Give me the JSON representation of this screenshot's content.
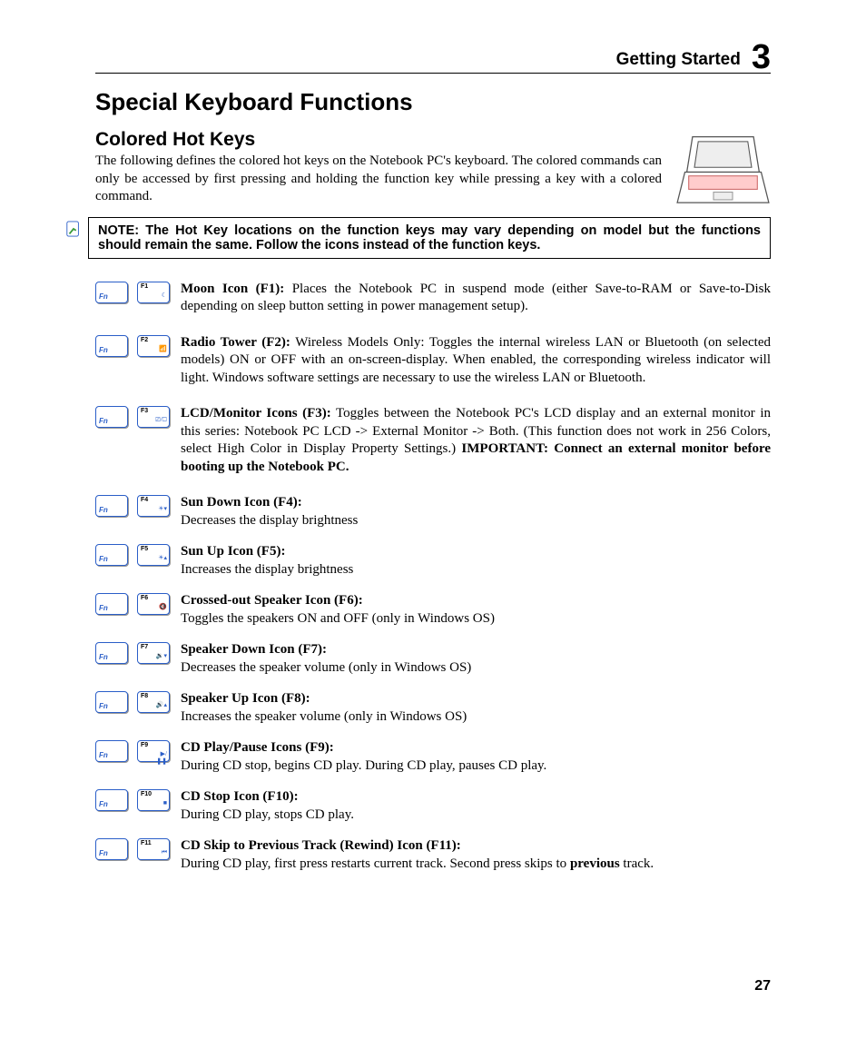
{
  "header": {
    "section_title": "Getting Started",
    "section_number": "3"
  },
  "page_title": "Special Keyboard Functions",
  "subsection_title": "Colored Hot Keys",
  "intro": "The following defines the colored hot keys on the Notebook PC's keyboard. The colored commands can only be accessed by first pressing and holding the function key while pressing a key with a colored command.",
  "note": "NOTE: The Hot Key locations on the function keys may vary depending on model but the functions should remain the same. Follow the icons instead of the function keys.",
  "items": [
    {
      "key_label": "F1",
      "label": "Moon Icon (F1):",
      "text": " Places the Notebook PC in suspend mode (either Save-to-RAM or Save-to-Disk depending on sleep button setting in power management setup)."
    },
    {
      "key_label": "F2",
      "label": "Radio Tower (F2):",
      "text": " Wireless Models Only: Toggles the internal wireless LAN or Bluetooth (on selected models) ON or OFF with an on-screen-display. When enabled, the corresponding wireless indicator will light. Windows software settings are necessary to use the wireless LAN or Bluetooth."
    },
    {
      "key_label": "F3",
      "label": "LCD/Monitor Icons (F3):",
      "text": " Toggles between the Notebook PC's LCD display and an external monitor in this series: Notebook PC LCD -> External Monitor -> Both. (This function does not work in 256 Colors, select High Color in Display Property Settings.) ",
      "trail_bold": "IMPORTANT: Connect an external monitor before booting up the Notebook PC."
    },
    {
      "key_label": "F4",
      "label": "Sun Down Icon (F4):",
      "break": true,
      "text": "Decreases the display brightness"
    },
    {
      "key_label": "F5",
      "label": "Sun Up Icon (F5):",
      "break": true,
      "text": "Increases the display brightness"
    },
    {
      "key_label": "F6",
      "label": "Crossed-out Speaker Icon (F6):",
      "break": true,
      "text": "Toggles the speakers ON and OFF (only in Windows OS)"
    },
    {
      "key_label": "F7",
      "label": "Speaker Down Icon (F7):",
      "break": true,
      "text": "Decreases the speaker volume (only in Windows OS)"
    },
    {
      "key_label": "F8",
      "label": "Speaker Up Icon (F8):",
      "break": true,
      "text": "Increases the speaker volume (only in Windows OS)"
    },
    {
      "key_label": "F9",
      "label": "CD Play/Pause Icons (F9):",
      "break": true,
      "text": "During CD stop, begins CD play. During CD play, pauses CD play."
    },
    {
      "key_label": "F10",
      "label": "CD Stop Icon (F10):",
      "break": true,
      "text": "During CD play, stops CD play."
    },
    {
      "key_label": "F11",
      "label": "CD Skip to Previous Track (Rewind) Icon (F11):",
      "break": true,
      "text": "During CD play, first press restarts current track. Second press skips to ",
      "trail_bold": "previous",
      "trail_after": " track."
    }
  ],
  "icons": {
    "F1": "☾",
    "F2": "📶",
    "F3": "⎚/▢",
    "F4": "☀▾",
    "F5": "☀▴",
    "F6": "🔇",
    "F7": "🔉▾",
    "F8": "🔊▴",
    "F9": "▶/❚❚",
    "F10": "■",
    "F11": "⏮"
  },
  "page_number": "27"
}
